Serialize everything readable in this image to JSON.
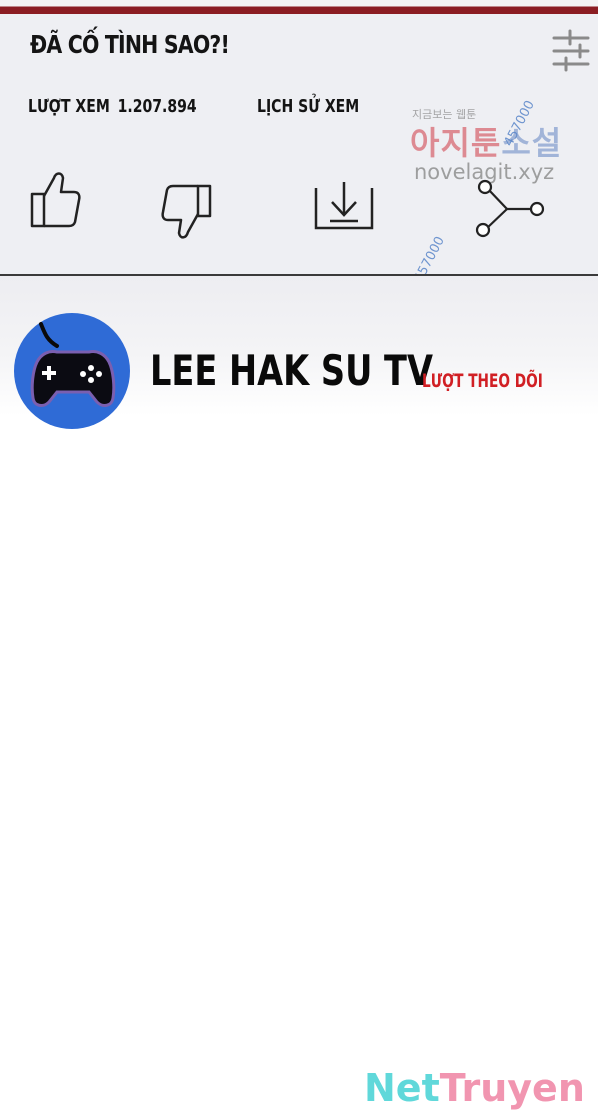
{
  "video": {
    "title": "ĐÃ CỐ TÌNH SAO?!",
    "views_label": "LƯỢT XEM",
    "views_count": "1.207.894",
    "history_label": "LỊCH SỬ XEM"
  },
  "actions": [
    {
      "icon": "thumbs-up-icon"
    },
    {
      "icon": "thumbs-down-icon"
    },
    {
      "icon": "download-icon"
    },
    {
      "icon": "share-icon"
    }
  ],
  "settings_icon": "sliders-icon",
  "channel": {
    "name": "LEE HAK SU TV",
    "follow_label": "LƯỢT THEO DÕI",
    "avatar_icon": "gamepad-icon"
  },
  "watermark": {
    "korean_small": "지금보는 웹툰",
    "korean_logo_red": "아지툰",
    "korean_logo_blue": "소설",
    "site": "novelagit.xyz",
    "number": "457000"
  },
  "brand": {
    "part1": "Net",
    "part2": "Truyen"
  },
  "colors": {
    "accent_bar": "#8b1d22",
    "follow_red": "#d11f24",
    "avatar_blue": "#2f6bd6",
    "brand_cyan": "#4fd4d6",
    "brand_pink": "#f08aa8"
  }
}
